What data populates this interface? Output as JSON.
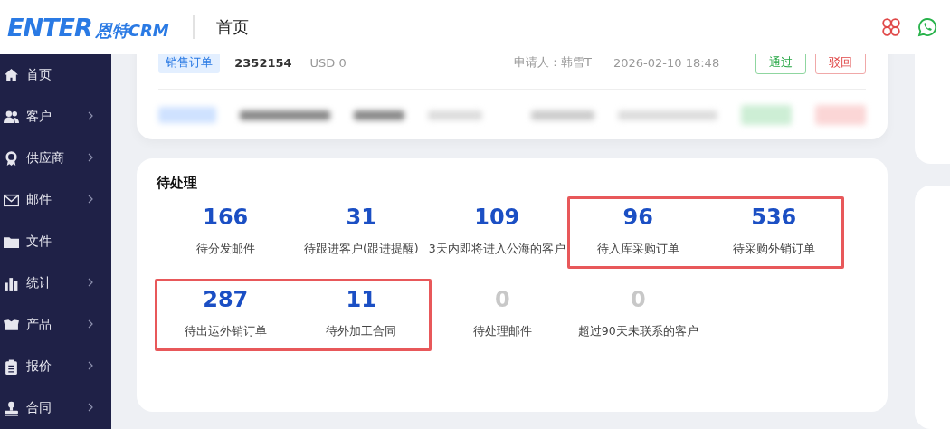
{
  "header": {
    "logo": {
      "mark": "ENTER",
      "name": "恩特CRM"
    },
    "title": "首页"
  },
  "sidebar": {
    "items": [
      {
        "label": "首页",
        "has_submenu": false
      },
      {
        "label": "客户",
        "has_submenu": true
      },
      {
        "label": "供应商",
        "has_submenu": true
      },
      {
        "label": "邮件",
        "has_submenu": true
      },
      {
        "label": "文件",
        "has_submenu": false
      },
      {
        "label": "统计",
        "has_submenu": true
      },
      {
        "label": "产品",
        "has_submenu": true
      },
      {
        "label": "报价",
        "has_submenu": true
      },
      {
        "label": "合同",
        "has_submenu": true
      }
    ]
  },
  "approvals": {
    "rows": [
      {
        "tag": "销售订单",
        "number": "2352154",
        "amount": "USD 0",
        "applicant": "申请人：韩雪T",
        "time": "2026-02-10 18:48",
        "approve": "通过",
        "reject": "驳回",
        "blurred": false
      },
      {
        "blurred": true
      }
    ]
  },
  "pending": {
    "title": "待处理",
    "rows": [
      [
        {
          "highlighted": false,
          "items": [
            {
              "count": "166",
              "label": "待分发邮件",
              "zero": false
            },
            {
              "count": "31",
              "label": "待跟进客户(跟进提醒)",
              "zero": false
            },
            {
              "count": "109",
              "label": "3天内即将进入公海的客户",
              "zero": false
            }
          ]
        },
        {
          "highlighted": true,
          "items": [
            {
              "count": "96",
              "label": "待入库采购订单",
              "zero": false
            },
            {
              "count": "536",
              "label": "待采购外销订单",
              "zero": false
            }
          ]
        }
      ],
      [
        {
          "highlighted": true,
          "items": [
            {
              "count": "287",
              "label": "待出运外销订单",
              "zero": false
            },
            {
              "count": "11",
              "label": "待外加工合同",
              "zero": false
            }
          ]
        },
        {
          "highlighted": false,
          "items": [
            {
              "count": "0",
              "label": "待处理邮件",
              "zero": true
            },
            {
              "count": "0",
              "label": "超过90天未联系的客户",
              "zero": true
            }
          ]
        }
      ]
    ]
  }
}
